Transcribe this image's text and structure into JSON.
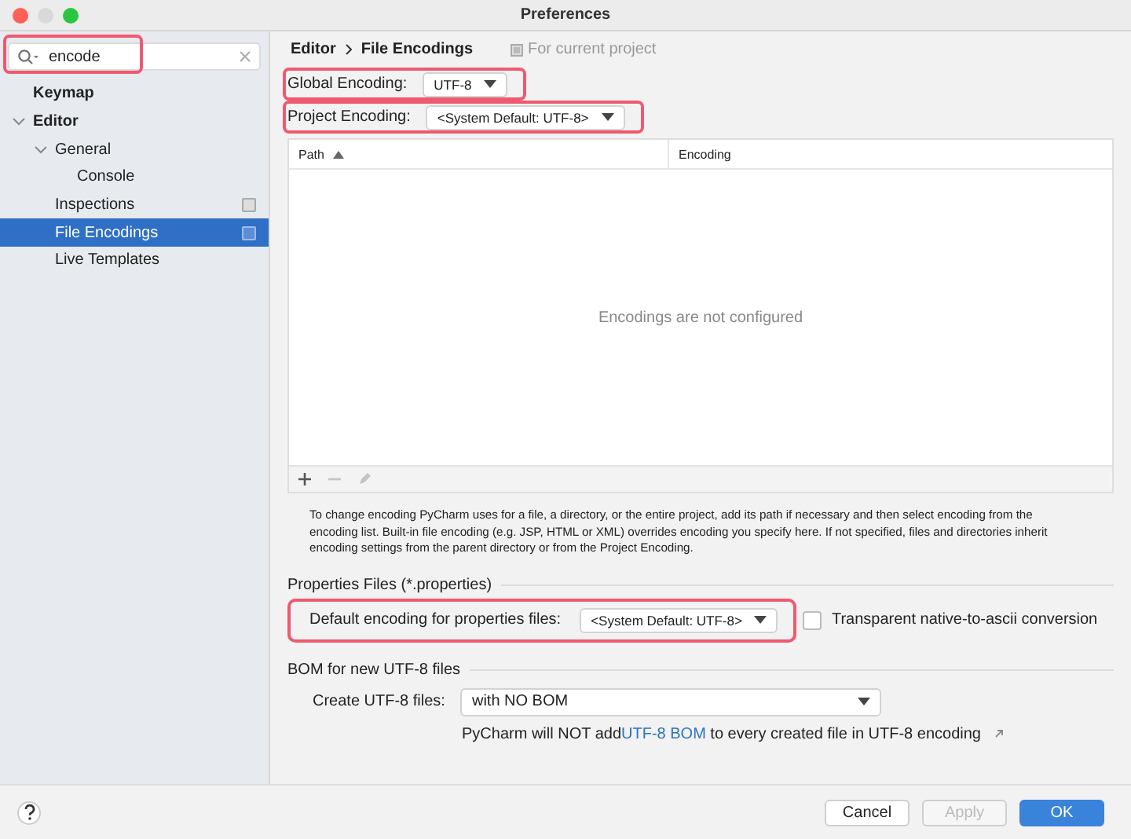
{
  "window": {
    "title": "Preferences"
  },
  "sidebar": {
    "search": {
      "value": "encode",
      "highlighted": true
    },
    "items": [
      {
        "label": "Keymap",
        "bold": true,
        "expanded": false,
        "selected": false,
        "project_icon": false
      },
      {
        "label": "Editor",
        "bold": true,
        "expanded": true,
        "selected": false,
        "project_icon": false,
        "children": [
          {
            "label": "General",
            "bold": false,
            "expanded": true,
            "selected": false,
            "project_icon": false,
            "children": [
              {
                "label": "Console",
                "bold": false,
                "expanded": false,
                "selected": false,
                "project_icon": false
              }
            ]
          },
          {
            "label": "Inspections",
            "bold": false,
            "expanded": false,
            "selected": false,
            "project_icon": true
          },
          {
            "label": "File Encodings",
            "bold": false,
            "expanded": false,
            "selected": true,
            "project_icon": true
          },
          {
            "label": "Live Templates",
            "bold": false,
            "expanded": false,
            "selected": false,
            "project_icon": false
          }
        ]
      }
    ]
  },
  "breadcrumb": [
    "Editor",
    "File Encodings"
  ],
  "scope_note": "For current project",
  "encodings": [
    {
      "label": "Global Encoding:",
      "value": "UTF-8",
      "highlighted": true
    },
    {
      "label": "Project Encoding:",
      "value": "<System Default: UTF-8>",
      "highlighted": true
    }
  ],
  "table": {
    "columns": [
      {
        "label": "Path",
        "sorted": true
      },
      {
        "label": "Encoding",
        "sorted": false
      }
    ],
    "empty_text": "Encodings are not configured",
    "toolbar": [
      {
        "kind": "add",
        "disabled": false
      },
      {
        "kind": "remove",
        "disabled": true
      },
      {
        "kind": "edit",
        "disabled": true
      }
    ]
  },
  "description": "To change encoding PyCharm uses for a file, a directory, or the entire project, add its path if necessary and then select encoding from the encoding list. Built-in file encoding (e.g. JSP, HTML or XML) overrides encoding you specify here. If not specified, files and directories inherit encoding settings from the parent directory or from the Project Encoding.",
  "properties": {
    "title": "Properties Files (*.properties)",
    "label": "Default encoding for properties files:",
    "value": "<System Default: UTF-8>",
    "highlighted": true,
    "checkbox": {
      "label": "Transparent native-to-ascii conversion",
      "checked": false
    }
  },
  "bom": {
    "title": "BOM for new UTF-8 files",
    "label": "Create UTF-8 files:",
    "value": "with NO BOM",
    "note": {
      "before": "PyCharm will NOT add",
      "link": "UTF-8 BOM",
      "after": " to every created file in UTF-8 encoding"
    }
  },
  "buttons": [
    {
      "label": "Cancel",
      "kind": "normal",
      "disabled": false
    },
    {
      "label": "Apply",
      "kind": "normal",
      "disabled": true
    },
    {
      "label": "OK",
      "kind": "default",
      "disabled": false
    }
  ]
}
